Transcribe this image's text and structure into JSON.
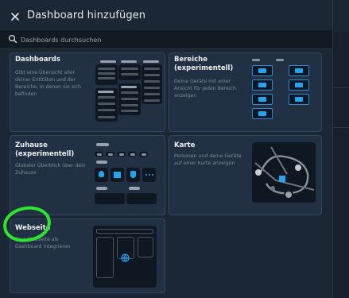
{
  "dialog": {
    "title": "Dashboard hinzufügen",
    "search_placeholder": "Dashboards durchsuchen"
  },
  "cards": {
    "dashboards": {
      "title": "Dashboards",
      "description": "Gibt eine Übersicht aller deiner Entitäten und der Bereiche, in denen sie sich befinden"
    },
    "areas": {
      "title": "Bereiche\n(experimentell)",
      "description": "Deine Geräte mit einer Ansicht für jeden Bereich anzeigen"
    },
    "home": {
      "title": "Zuhause\n(experimentell)",
      "description": "Globaler Überblick über dein Zuhause"
    },
    "map": {
      "title": "Karte",
      "description": "Personen und deine Geräte auf einer Karte anzeigen"
    },
    "webpage": {
      "title": "Webseite",
      "description": "Eine Webseite als Dashboard integrieren"
    }
  },
  "colors": {
    "accent": "#1f8ee0",
    "highlight": "#2ee52e",
    "card_bg": "#223044"
  }
}
